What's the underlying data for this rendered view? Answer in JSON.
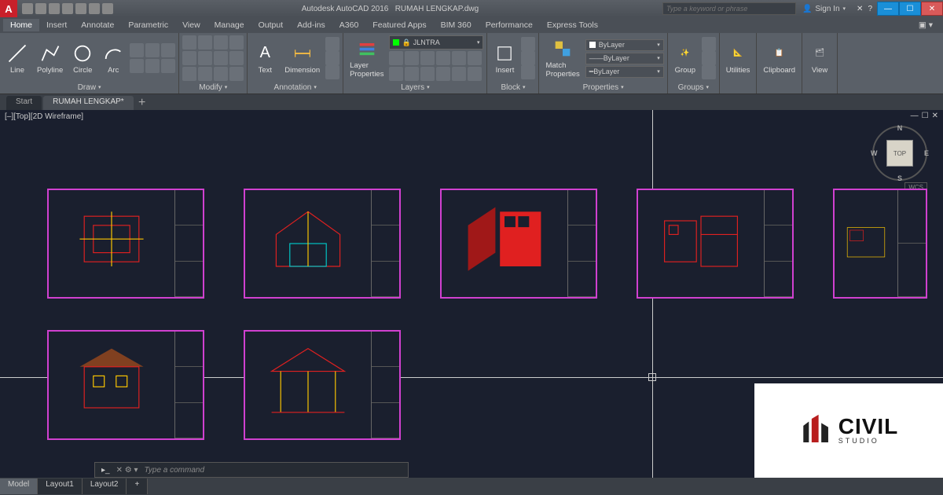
{
  "title_app": "Autodesk AutoCAD 2016",
  "title_file": "RUMAH LENGKAP.dwg",
  "search_placeholder": "Type a keyword or phrase",
  "signin": "Sign In",
  "menu": [
    "Home",
    "Insert",
    "Annotate",
    "Parametric",
    "View",
    "Manage",
    "Output",
    "Add-ins",
    "A360",
    "Featured Apps",
    "BIM 360",
    "Performance",
    "Express Tools"
  ],
  "menu_active": 0,
  "ribbon": {
    "draw": {
      "title": "Draw",
      "items": [
        "Line",
        "Polyline",
        "Circle",
        "Arc"
      ]
    },
    "modify": {
      "title": "Modify"
    },
    "annotation": {
      "title": "Annotation",
      "items": [
        "Text",
        "Dimension"
      ]
    },
    "layers": {
      "title": "Layers",
      "btn": "Layer\nProperties",
      "current": "JLNTRA"
    },
    "block": {
      "title": "Block",
      "items": [
        "Insert"
      ]
    },
    "match": "Match\nProperties",
    "properties": {
      "title": "Properties",
      "c1": "ByLayer",
      "c2": "ByLayer",
      "c3": "ByLayer"
    },
    "groups": {
      "title": "Groups",
      "btn": "Group"
    },
    "utilities": "Utilities",
    "clipboard": "Clipboard",
    "view": "View"
  },
  "file_tabs": [
    "Start",
    "RUMAH LENGKAP*"
  ],
  "file_tab_active": 1,
  "view_label": "[–][Top][2D Wireframe]",
  "navcube": {
    "face": "TOP",
    "n": "N",
    "s": "S",
    "e": "E",
    "w": "W",
    "wcs": "WCS"
  },
  "cmd_prompt": "Type a command",
  "layout_tabs": [
    "Model",
    "Layout1",
    "Layout2"
  ],
  "layout_active": 0,
  "watermark": {
    "name": "CIVIL",
    "sub": "STUDIO"
  }
}
